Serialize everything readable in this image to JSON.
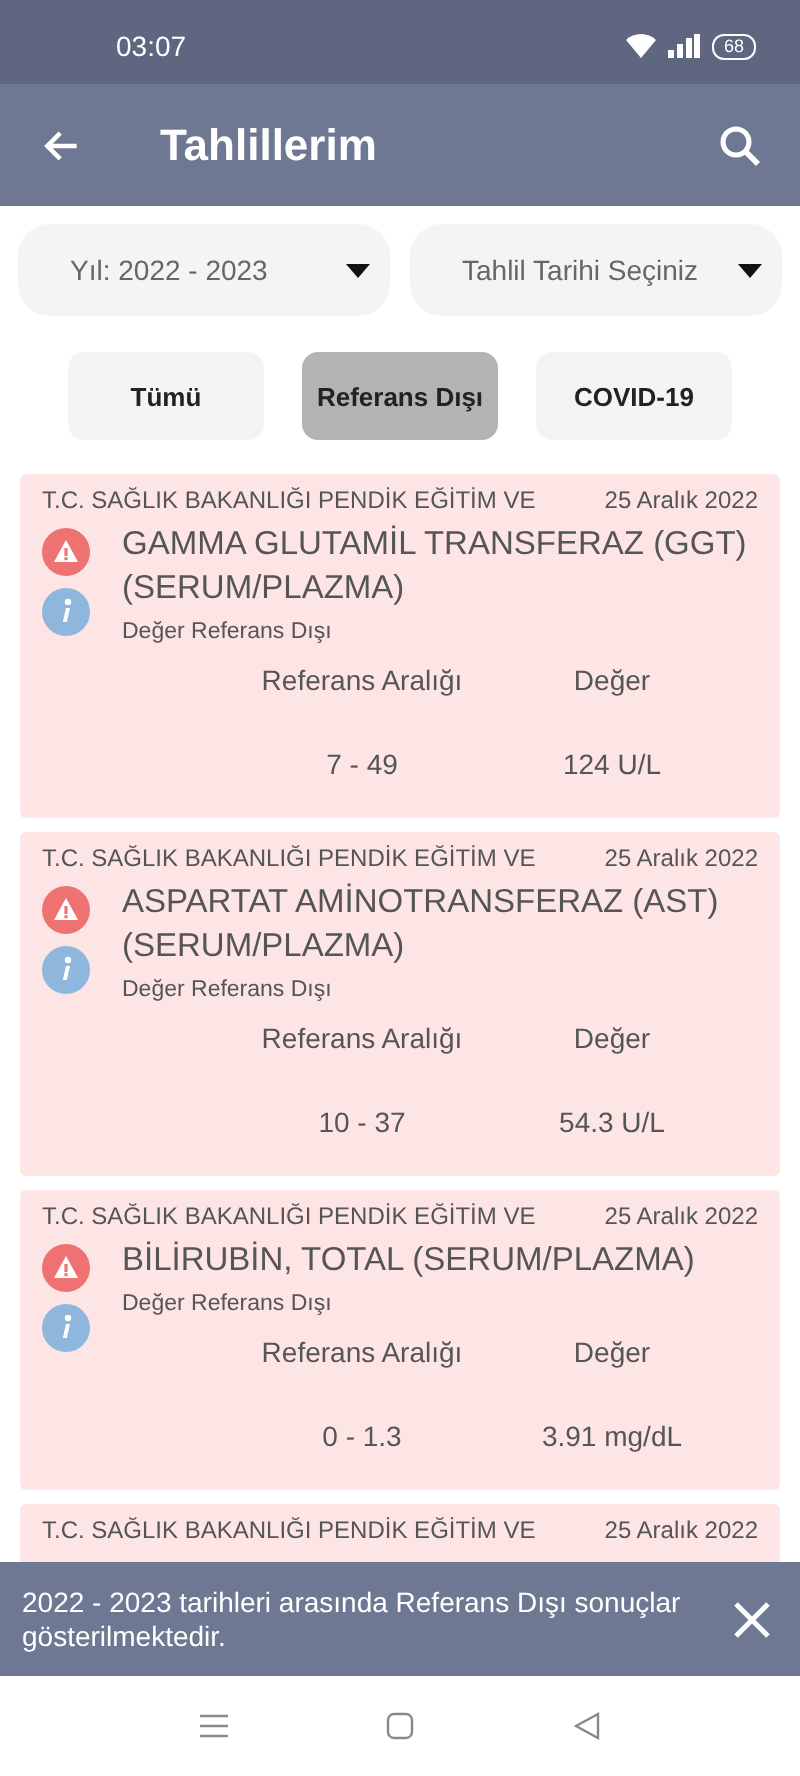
{
  "status_bar": {
    "time": "03:07",
    "battery": "68"
  },
  "app_bar": {
    "title": "Tahlillerim"
  },
  "filters": [
    {
      "label": "Yıl: 2022 - 2023"
    },
    {
      "label": "Tahlil Tarihi Seçiniz"
    }
  ],
  "chips": [
    {
      "label": "Tümü",
      "selected": false
    },
    {
      "label": "Referans Dışı",
      "selected": true
    },
    {
      "label": "COVID-19",
      "selected": false
    }
  ],
  "results": [
    {
      "source": "T.C. SAĞLIK BAKANLIĞI PENDİK EĞİTİM VE",
      "date": "25 Aralık 2022",
      "test": "GAMMA GLUTAMİL TRANSFERAZ (GGT) (SERUM/PLAZMA)",
      "status": "Değer Referans Dışı",
      "range_label": "Referans Aralığı",
      "value_label": "Değer",
      "range": "7 - 49",
      "value": "124 U/L"
    },
    {
      "source": "T.C. SAĞLIK BAKANLIĞI PENDİK EĞİTİM VE",
      "date": "25 Aralık 2022",
      "test": "ASPARTAT AMİNOTRANSFERAZ (AST) (SERUM/PLAZMA)",
      "status": "Değer Referans Dışı",
      "range_label": "Referans Aralığı",
      "value_label": "Değer",
      "range": "10 - 37",
      "value": "54.3 U/L"
    },
    {
      "source": "T.C. SAĞLIK BAKANLIĞI PENDİK EĞİTİM VE",
      "date": "25 Aralık 2022",
      "test": "BİLİRUBİN, TOTAL (SERUM/PLAZMA)",
      "status": "Değer Referans Dışı",
      "range_label": "Referans Aralığı",
      "value_label": "Değer",
      "range": "0 - 1.3",
      "value": "3.91 mg/dL"
    },
    {
      "source": "T.C. SAĞLIK BAKANLIĞI PENDİK EĞİTİM VE",
      "date": "25 Aralık 2022"
    }
  ],
  "snackbar": {
    "message": "2022 - 2023 tarihleri arasında Referans Dışı sonuçlar gösterilmektedir."
  }
}
